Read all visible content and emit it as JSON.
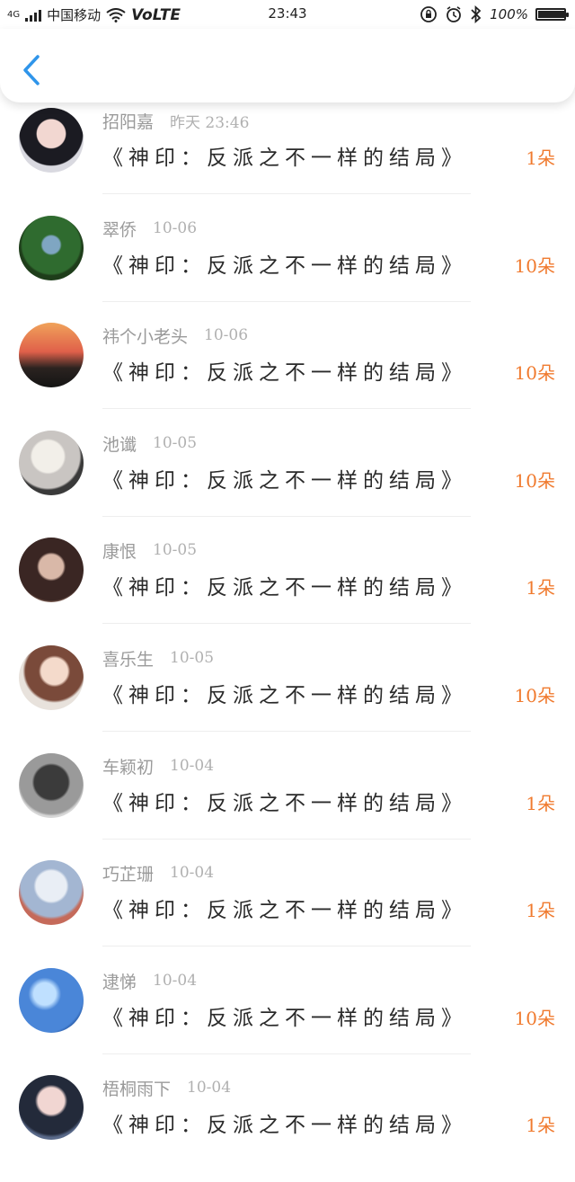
{
  "status_bar": {
    "network": "4G",
    "carrier": "中国移动",
    "volte": "VoLTE",
    "time": "23:43",
    "battery": "100%",
    "battery_level": 1.0
  },
  "header": {
    "back_icon": "chevron-left-icon",
    "accent_color": "#2f95ea"
  },
  "colors": {
    "count": "#f07a2e",
    "name": "#9a9a9a",
    "divider": "#eeeeee"
  },
  "rows": [
    {
      "name": "招阳嘉",
      "date": "昨天 23:46",
      "title": "《神印：反派之不一样的结局》",
      "count": "1朵"
    },
    {
      "name": "翠侨",
      "date": "10-06",
      "title": "《神印：反派之不一样的结局》",
      "count": "10朵"
    },
    {
      "name": "祎个小老头",
      "date": "10-06",
      "title": "《神印：反派之不一样的结局》",
      "count": "10朵"
    },
    {
      "name": "池谶",
      "date": "10-05",
      "title": "《神印：反派之不一样的结局》",
      "count": "10朵"
    },
    {
      "name": "康恨",
      "date": "10-05",
      "title": "《神印：反派之不一样的结局》",
      "count": "1朵"
    },
    {
      "name": "喜乐生",
      "date": "10-05",
      "title": "《神印：反派之不一样的结局》",
      "count": "10朵"
    },
    {
      "name": "车颖初",
      "date": "10-04",
      "title": "《神印：反派之不一样的结局》",
      "count": "1朵"
    },
    {
      "name": "巧芷珊",
      "date": "10-04",
      "title": "《神印：反派之不一样的结局》",
      "count": "1朵"
    },
    {
      "name": "逮悌",
      "date": "10-04",
      "title": "《神印：反派之不一样的结局》",
      "count": "10朵"
    },
    {
      "name": "梧桐雨下",
      "date": "10-04",
      "title": "《神印：反派之不一样的结局》",
      "count": "1朵"
    }
  ]
}
